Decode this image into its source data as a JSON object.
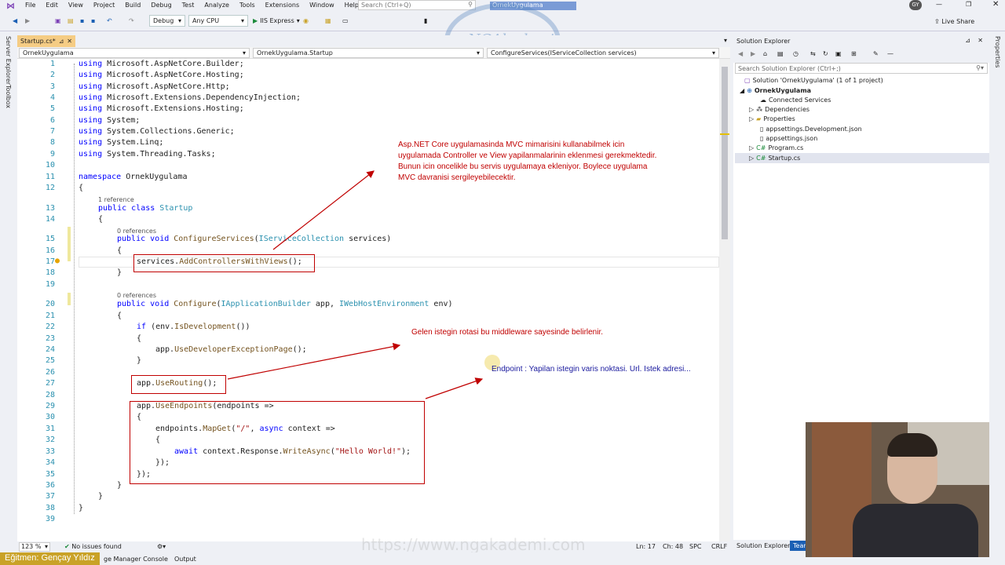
{
  "menu": [
    "File",
    "Edit",
    "View",
    "Project",
    "Build",
    "Debug",
    "Test",
    "Analyze",
    "Tools",
    "Extensions",
    "Window",
    "Help"
  ],
  "search_placeholder": "Search (Ctrl+Q)",
  "solution_title": "OrnekUygulama",
  "user_initials": "GY",
  "live_share": "Live Share",
  "toolbar": {
    "config": "Debug",
    "platform": "Any CPU",
    "run": "IIS Express"
  },
  "left_strip": [
    "Server Explorer",
    "Toolbox"
  ],
  "editor_tab": "Startup.cs*",
  "nav": {
    "project": "OrnekUygulama",
    "class": "OrnekUygulama.Startup",
    "member": "ConfigureServices(IServiceCollection services)"
  },
  "lines": [
    "1",
    "2",
    "3",
    "4",
    "5",
    "6",
    "7",
    "8",
    "9",
    "10",
    "11",
    "12",
    "13",
    "14",
    "15",
    "16",
    "17",
    "18",
    "19",
    "20",
    "21",
    "22",
    "23",
    "24",
    "25",
    "26",
    "27",
    "28",
    "29",
    "30",
    "31",
    "32",
    "33",
    "34",
    "35",
    "36",
    "37",
    "38",
    "39"
  ],
  "refs": {
    "r13": "1 reference",
    "r15": "0 references",
    "r20": "0 references"
  },
  "notes": {
    "n1": [
      "Asp.NET Core uygulamasinda MVC mimarisini kullanabilmek icin",
      "uygulamada Controller ve View yapilanmalarinin eklenmesi gerekmektedir.",
      "Bunun icin oncelikle bu servis uygulamaya ekleniyor. Boylece uygulama",
      "MVC davranisi sergileyebilecektir."
    ],
    "n2": "Gelen istegin rotasi bu middleware sayesinde belirlenir.",
    "n3": "Endpoint : Yapilan istegin varis noktasi. Url. Istek adresi..."
  },
  "status": {
    "zoom": "123 %",
    "issues": "No issues found",
    "ln": "Ln: 17",
    "ch": "Ch: 48",
    "spc": "SPC",
    "crlf": "CRLF"
  },
  "bottom": {
    "instructor": "Eğitmen: Gençay Yıldız",
    "pkg": "ge Manager Console",
    "output": "Output"
  },
  "watermark": "https://www.ngakademi.com",
  "logo": "NGAkademi",
  "se": {
    "title": "Solution Explorer",
    "search": "Search Solution Explorer (Ctrl+;)",
    "items": [
      "Solution 'OrnekUygulama' (1 of 1 project)",
      "OrnekUygulama",
      "Connected Services",
      "Dependencies",
      "Properties",
      "appsettings.Development.json",
      "appsettings.json",
      "Program.cs",
      "Startup.cs"
    ],
    "tabs": [
      "Solution Explorer",
      "Team"
    ]
  },
  "right_strip": "Properties"
}
